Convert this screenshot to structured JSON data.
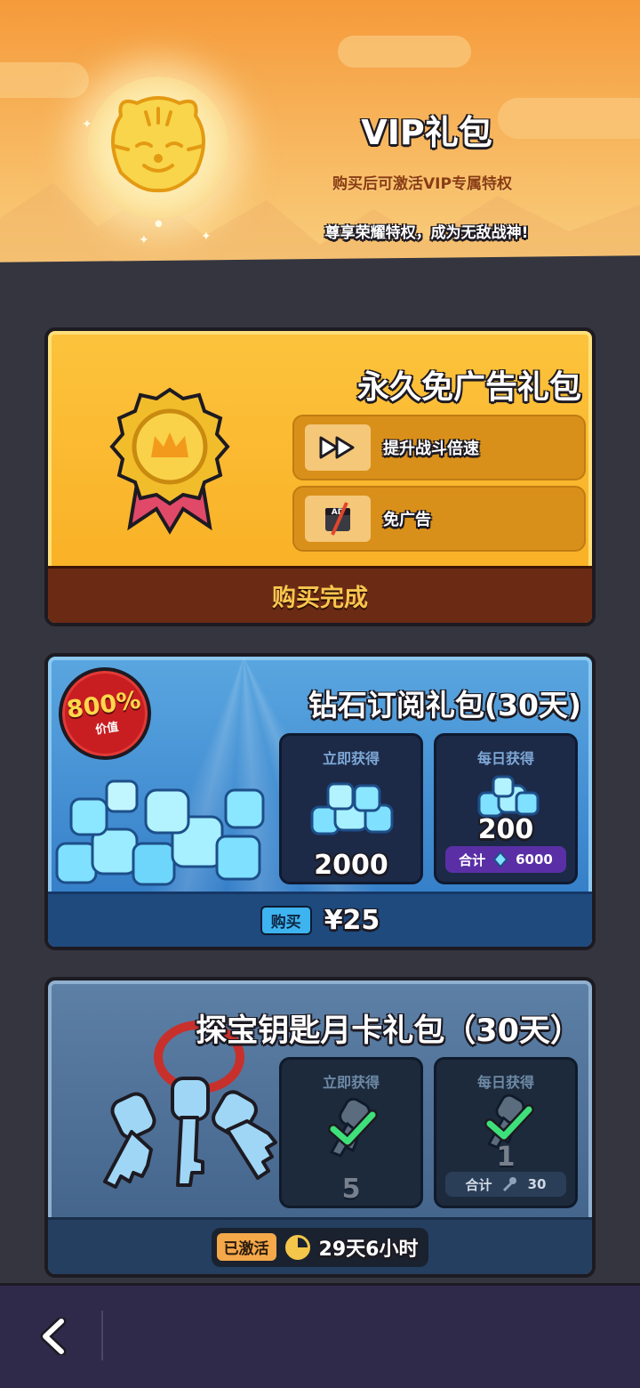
{
  "header": {
    "title": "VIP礼包",
    "subtitle": "购买后可激活VIP专属特权",
    "slogan": "尊享荣耀特权，成为无敌战神!",
    "icon": "tiger-sun-emblem"
  },
  "no_ads_pack": {
    "title": "永久免广告礼包",
    "icon": "gold-crown-medal",
    "features": [
      {
        "icon": "fast-forward-icon",
        "label": "提升战斗倍速"
      },
      {
        "icon": "no-ads-icon",
        "label": "免广告",
        "icon_text": "AD"
      }
    ],
    "status": "购买完成"
  },
  "diamond_pack": {
    "title": "钻石订阅礼包(30天)",
    "badge_percent": "800%",
    "badge_label": "价值",
    "instant": {
      "label": "立即获得",
      "value": "2000",
      "icon": "diamond-pile-icon"
    },
    "daily": {
      "label": "每日获得",
      "value": "200",
      "total_label": "合计",
      "total_value": "6000",
      "icon": "diamond-pile-icon"
    },
    "buy_label": "购买",
    "price": "¥25"
  },
  "key_pack": {
    "title": "探宝钥匙月卡礼包（30天）",
    "icon": "key-ring-icon",
    "instant": {
      "label": "立即获得",
      "value": "5",
      "claimed": true
    },
    "daily": {
      "label": "每日获得",
      "value": "1",
      "total_label": "合计",
      "total_value": "30",
      "claimed": true
    },
    "status_tag": "已激活",
    "remaining": "29天6小时"
  },
  "nav": {
    "back_icon": "chevron-left-icon"
  },
  "colors": {
    "header_orange": "#f7b35a",
    "gold_card": "#f9ad22",
    "blue_card": "#2e77c4",
    "steel_card": "#3f5f86",
    "background": "#34353f"
  }
}
